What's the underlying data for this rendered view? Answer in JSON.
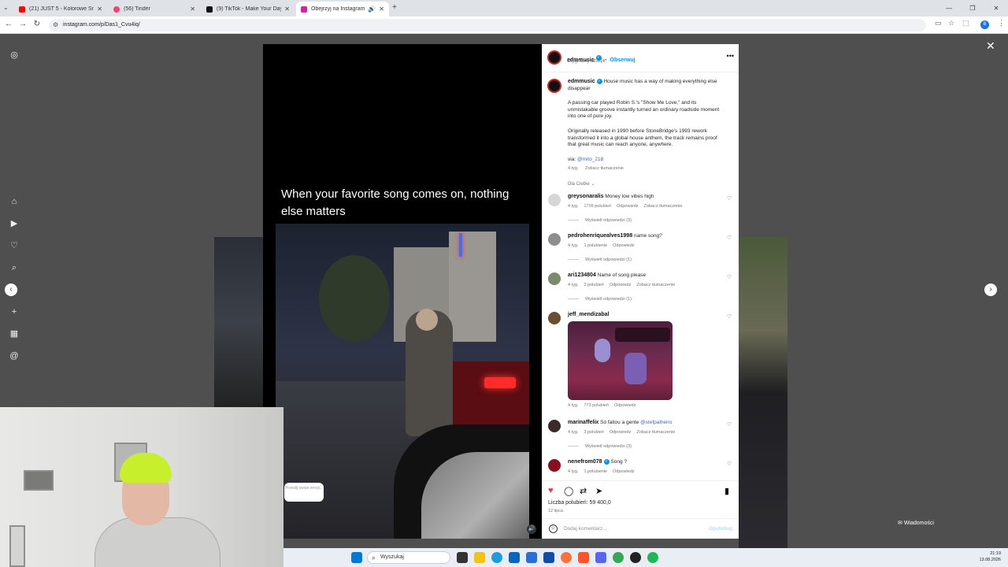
{
  "browser": {
    "tabs": [
      {
        "label": "(21) JUST 5 - Kolorowe Sny 202...",
        "color": "#ff0000",
        "active": false
      },
      {
        "label": "(56) Tinder",
        "color": "#fe3c72",
        "active": false
      },
      {
        "label": "(9) TikTok - Make Your Day",
        "color": "#111111",
        "active": false
      },
      {
        "label": "Obejrzyj na Instagramie rolk...",
        "color": "#d6249f",
        "active": true
      }
    ],
    "new_tab": "+",
    "url": "instagram.com/p/Das1_Cvu4iq/",
    "profile_initial": "B"
  },
  "post": {
    "author": "edmmusic",
    "follow": "Obserwuj",
    "audio": "Oryginalny dźwięk",
    "overlay_caption": "When your favorite song comes on, nothing else matters",
    "caption_lines": [
      "House music has a way of making everything else disappear",
      "A passing car played Robin S.'s \"Show Me Love,\" and its unmistakable groove instantly turned an ordinary roadside moment into one of pure joy.",
      "Originally released in 1990 before StoneBridge's 1993 rework transformed it into a global house anthem, the track remains proof that great music can reach anyone, anywhere."
    ],
    "via_label": "via:",
    "via_handle": "@mito_218",
    "caption_time": "4 tyg.",
    "caption_translate": "Zobacz tłumaczenie",
    "filter": "Dla Ciebie",
    "likes": "Liczba polubień: 59 400,0",
    "date": "12 lipca",
    "comment_placeholder": "Dodaj komentarz...",
    "publish": "Opublikuj"
  },
  "comments": [
    {
      "user": "greysonaralis",
      "text": "Money low vibes high",
      "time": "4 tyg.",
      "likes": "1709 polubień",
      "reply": "Odpowiedz",
      "translate": "Zobacz tłumaczenie",
      "replies": "Wyświetl odpowiedzi (3)"
    },
    {
      "user": "pedrohenriquealves1998",
      "text": "name song?",
      "time": "4 tyg.",
      "likes": "1 polubienie",
      "reply": "Odpowiedz",
      "replies": "Wyświetl odpowiedzi (1)"
    },
    {
      "user": "ari1234804",
      "text": "Name of song please",
      "time": "4 tyg.",
      "likes": "3 polubień",
      "reply": "Odpowiedz",
      "translate": "Zobacz tłumaczenie",
      "replies": "Wyświetl odpowiedzi (1)"
    },
    {
      "user": "jeff_mendizabal",
      "text": "",
      "time": "4 tyg.",
      "likes": "773 polubień",
      "reply": "Odpowiedz"
    },
    {
      "user": "marinaffelix",
      "text": "Só faltou a gente",
      "mention": "@stefpalheiro",
      "time": "4 tyg.",
      "likes": "3 polubień",
      "reply": "Odpowiedz",
      "translate": "Zobacz tłumaczenie",
      "replies": "Wyświetl odpowiedzi (3)"
    },
    {
      "user": "nenefrom078",
      "text": "Song ?",
      "time": "4 tyg.",
      "likes": "1 polubienie",
      "reply": "Odpowiedz"
    }
  ],
  "overlay": {
    "notification": "Prześlij swoje emoji..."
  },
  "taskbar": {
    "search": "Wyszukaj",
    "time": "21:19",
    "date": "13.08.2026"
  },
  "messages": "Wiadomości",
  "icons": [
    "instagram-icon",
    "home-icon",
    "reels-icon",
    "notifications-icon",
    "search-icon",
    "create-icon",
    "dashboard-icon",
    "threads-icon"
  ]
}
